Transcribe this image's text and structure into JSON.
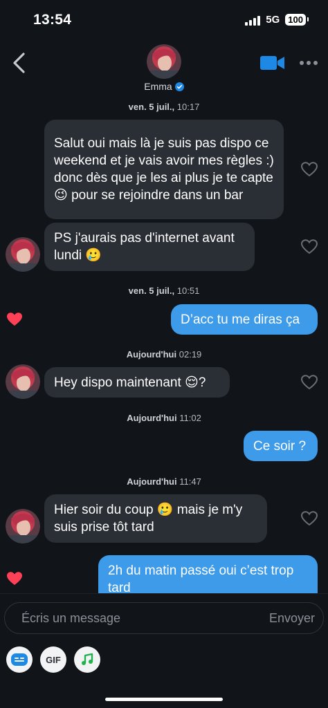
{
  "status": {
    "time": "13:54",
    "network": "5G",
    "battery": "100"
  },
  "header": {
    "name": "Emma",
    "verified": true
  },
  "colors": {
    "background": "#111418",
    "incoming_bubble": "#2a2e35",
    "outgoing_bubble": "#3d9be9",
    "accent": "#1e88e5",
    "like": "#ff4158"
  },
  "messages": [
    {
      "timestamp_day": "ven. 5 juil.,",
      "timestamp_time": "10:17"
    },
    {
      "direction": "in",
      "text": "Salut oui mais là je suis pas dispo ce weekend et je vais avoir mes règles :) donc dès que je les ai plus je te capte 😉 pour se rejoindre dans un bar",
      "liked": false
    },
    {
      "direction": "in",
      "text": "PS j'aurais pas d'internet avant lundi 🥲",
      "liked": false
    },
    {
      "timestamp_day": "ven. 5 juil.,",
      "timestamp_time": "10:51"
    },
    {
      "direction": "out",
      "text": "D’acc tu me diras ça",
      "liked": true
    },
    {
      "timestamp_day": "Aujourd'hui",
      "timestamp_time": "02:19"
    },
    {
      "direction": "in",
      "text": "Hey dispo maintenant 😌?",
      "liked": false
    },
    {
      "timestamp_day": "Aujourd'hui",
      "timestamp_time": "11:02"
    },
    {
      "direction": "out",
      "text": "Ce soir ?",
      "liked": false
    },
    {
      "timestamp_day": "Aujourd'hui",
      "timestamp_time": "11:47"
    },
    {
      "direction": "in",
      "text": "Hier soir du coup 🥲 mais je m'y suis prise tôt tard",
      "liked": false
    },
    {
      "direction": "out",
      "text": "2h du matin passé oui c’est trop tard",
      "liked": true
    }
  ],
  "composer": {
    "placeholder": "Écris un message",
    "send_label": "Envoyer",
    "gif_label": "GIF"
  },
  "icons": [
    "back-icon",
    "video-call-icon",
    "more-icon",
    "verified-icon",
    "heart-icon",
    "sticker-icon",
    "music-icon"
  ]
}
